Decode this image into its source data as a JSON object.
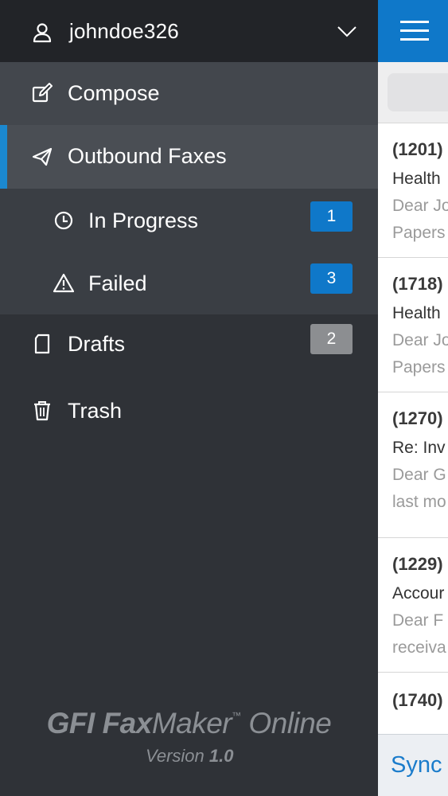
{
  "user": {
    "username": "johndoe326"
  },
  "nav": {
    "compose": "Compose",
    "outbound": "Outbound Faxes",
    "in_progress": {
      "label": "In Progress",
      "count": "1"
    },
    "failed": {
      "label": "Failed",
      "count": "3"
    },
    "drafts": {
      "label": "Drafts",
      "count": "2"
    },
    "trash": "Trash"
  },
  "branding": {
    "brand_bold": "GFI Fax",
    "brand_mid": "Maker",
    "brand_tm": "™",
    "brand_suffix": " Online",
    "version_label": "Version",
    "version_num": "1.0"
  },
  "messages": [
    {
      "id": "(1201)",
      "subject": "Health",
      "preview1": "Dear Jo",
      "preview2": "Papers"
    },
    {
      "id": "(1718)",
      "subject": "Health",
      "preview1": "Dear Jo",
      "preview2": "Papers"
    },
    {
      "id": "(1270)",
      "subject": "Re: Inv",
      "preview1": "Dear G",
      "preview2": "last mo"
    },
    {
      "id": "(1229)",
      "subject": "Accour",
      "preview1": "Dear F",
      "preview2": "receiva"
    },
    {
      "id": "(1740)",
      "subject": "",
      "preview1": "",
      "preview2": ""
    }
  ],
  "footer": {
    "sync": "Sync"
  },
  "colors": {
    "accent": "#0f78c9",
    "sidebar_bg": "#2f3237",
    "badge_grey": "#8c8e91"
  }
}
